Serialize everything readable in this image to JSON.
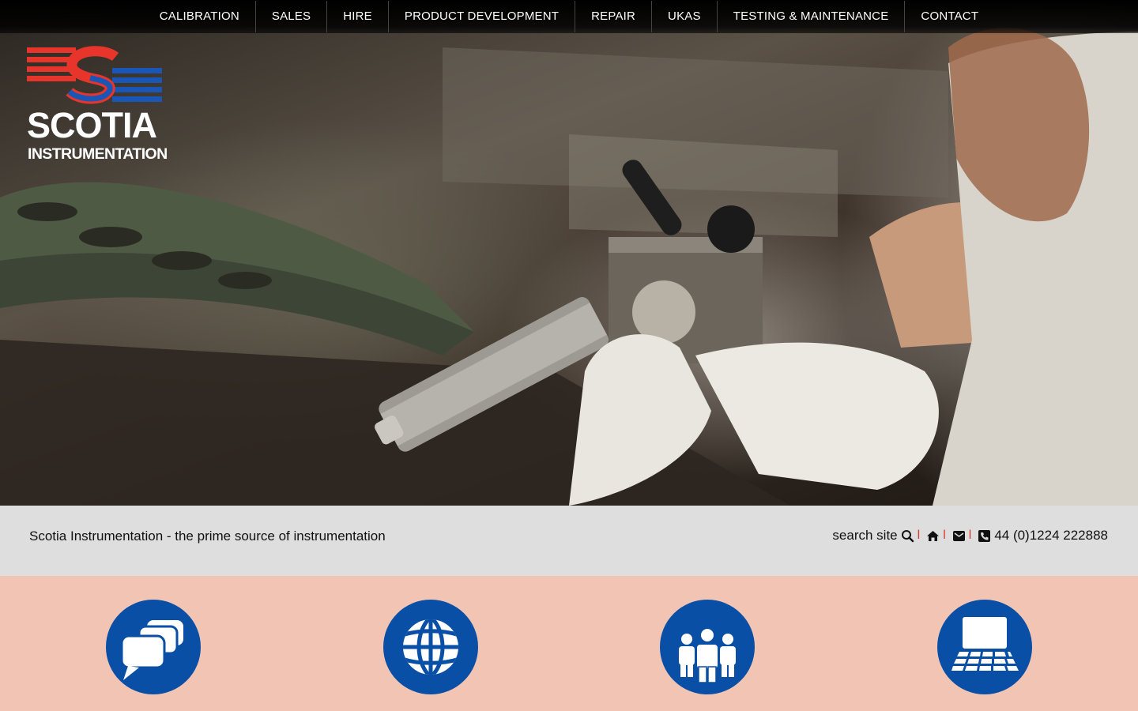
{
  "nav": {
    "items": [
      {
        "label": "CALIBRATION"
      },
      {
        "label": "SALES"
      },
      {
        "label": "HIRE"
      },
      {
        "label": "PRODUCT DEVELOPMENT"
      },
      {
        "label": "REPAIR"
      },
      {
        "label": "UKAS"
      },
      {
        "label": "TESTING & MAINTENANCE"
      },
      {
        "label": "CONTACT"
      }
    ]
  },
  "logo": {
    "line1": "SCOTIA",
    "line2": "INSTRUMENTATION",
    "colors": {
      "red": "#e8352b",
      "blue": "#1a56b5"
    }
  },
  "info_bar": {
    "tagline": "Scotia Instrumentation - the prime source of instrumentation",
    "search_label": "search site",
    "phone": "44 (0)1224 222888",
    "separator": "l"
  },
  "services": {
    "icons": [
      {
        "icon": "chat-bubbles-icon"
      },
      {
        "icon": "globe-icon"
      },
      {
        "icon": "team-icon"
      },
      {
        "icon": "laptop-icon"
      }
    ],
    "circle_color": "#0a4fa6"
  },
  "colors": {
    "nav_bg": "#000000",
    "info_bg": "#dedede",
    "services_bg": "#f2c4b3",
    "accent_red": "#e03a2a"
  }
}
